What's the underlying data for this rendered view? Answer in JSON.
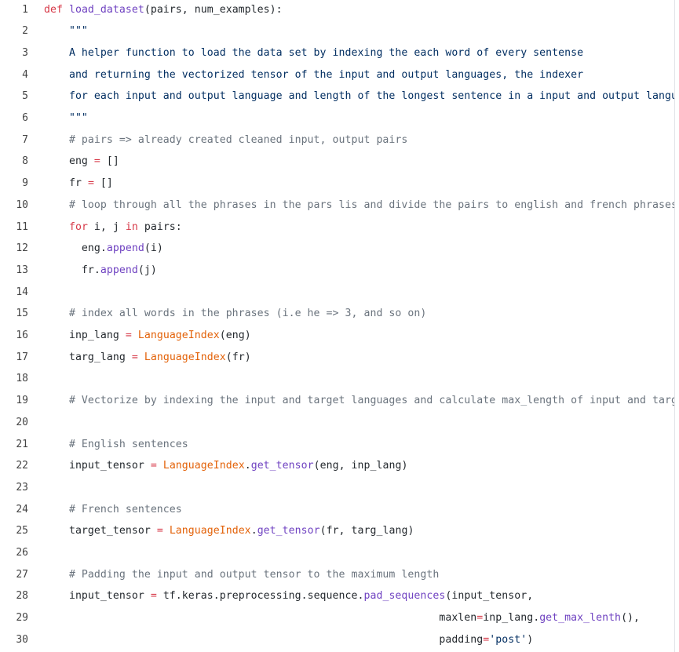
{
  "code_lines": [
    {
      "num": "1",
      "tokens": [
        {
          "t": "def ",
          "c": "k"
        },
        {
          "t": "load_dataset",
          "c": "f"
        },
        {
          "t": "(pairs, num_examples):",
          "c": ""
        }
      ]
    },
    {
      "num": "2",
      "tokens": [
        {
          "t": "    \"\"\"",
          "c": "s"
        }
      ]
    },
    {
      "num": "3",
      "tokens": [
        {
          "t": "    A helper function to load the data set by indexing the each word of every sentense",
          "c": "s"
        }
      ]
    },
    {
      "num": "4",
      "tokens": [
        {
          "t": "    and returning the vectorized tensor of the input and output languages, the indexer",
          "c": "s"
        }
      ]
    },
    {
      "num": "5",
      "tokens": [
        {
          "t": "    for each input and output language and length of the longest sentence in a input and output language",
          "c": "s"
        }
      ]
    },
    {
      "num": "6",
      "tokens": [
        {
          "t": "    \"\"\"",
          "c": "s"
        }
      ]
    },
    {
      "num": "7",
      "tokens": [
        {
          "t": "    # pairs => already created cleaned input, output pairs",
          "c": "c"
        }
      ]
    },
    {
      "num": "8",
      "tokens": [
        {
          "t": "    eng ",
          "c": ""
        },
        {
          "t": "=",
          "c": "o"
        },
        {
          "t": " []",
          "c": ""
        }
      ]
    },
    {
      "num": "9",
      "tokens": [
        {
          "t": "    fr ",
          "c": ""
        },
        {
          "t": "=",
          "c": "o"
        },
        {
          "t": " []",
          "c": ""
        }
      ]
    },
    {
      "num": "10",
      "tokens": [
        {
          "t": "    # loop through all the phrases in the pars lis and divide the pairs to english and french phrases",
          "c": "c"
        }
      ]
    },
    {
      "num": "11",
      "tokens": [
        {
          "t": "    ",
          "c": ""
        },
        {
          "t": "for",
          "c": "k"
        },
        {
          "t": " i, j ",
          "c": ""
        },
        {
          "t": "in",
          "c": "k"
        },
        {
          "t": " pairs:",
          "c": ""
        }
      ]
    },
    {
      "num": "12",
      "tokens": [
        {
          "t": "      eng.",
          "c": ""
        },
        {
          "t": "append",
          "c": "f"
        },
        {
          "t": "(i)",
          "c": ""
        }
      ]
    },
    {
      "num": "13",
      "tokens": [
        {
          "t": "      fr.",
          "c": ""
        },
        {
          "t": "append",
          "c": "f"
        },
        {
          "t": "(j)",
          "c": ""
        }
      ]
    },
    {
      "num": "14",
      "tokens": []
    },
    {
      "num": "15",
      "tokens": [
        {
          "t": "    # index all words in the phrases (i.e he => 3, and so on)",
          "c": "c"
        }
      ]
    },
    {
      "num": "16",
      "tokens": [
        {
          "t": "    inp_lang ",
          "c": ""
        },
        {
          "t": "=",
          "c": "o"
        },
        {
          "t": " ",
          "c": ""
        },
        {
          "t": "LanguageIndex",
          "c": "cl"
        },
        {
          "t": "(eng)",
          "c": ""
        }
      ]
    },
    {
      "num": "17",
      "tokens": [
        {
          "t": "    targ_lang ",
          "c": ""
        },
        {
          "t": "=",
          "c": "o"
        },
        {
          "t": " ",
          "c": ""
        },
        {
          "t": "LanguageIndex",
          "c": "cl"
        },
        {
          "t": "(fr)",
          "c": ""
        }
      ]
    },
    {
      "num": "18",
      "tokens": []
    },
    {
      "num": "19",
      "tokens": [
        {
          "t": "    # Vectorize by indexing the input and target languages and calculate max_length of input and target",
          "c": "c"
        }
      ]
    },
    {
      "num": "20",
      "tokens": []
    },
    {
      "num": "21",
      "tokens": [
        {
          "t": "    # English sentences",
          "c": "c"
        }
      ]
    },
    {
      "num": "22",
      "tokens": [
        {
          "t": "    input_tensor ",
          "c": ""
        },
        {
          "t": "=",
          "c": "o"
        },
        {
          "t": " ",
          "c": ""
        },
        {
          "t": "LanguageIndex",
          "c": "cl"
        },
        {
          "t": ".",
          "c": ""
        },
        {
          "t": "get_tensor",
          "c": "f"
        },
        {
          "t": "(eng, inp_lang)",
          "c": ""
        }
      ]
    },
    {
      "num": "23",
      "tokens": []
    },
    {
      "num": "24",
      "tokens": [
        {
          "t": "    # French sentences",
          "c": "c"
        }
      ]
    },
    {
      "num": "25",
      "tokens": [
        {
          "t": "    target_tensor ",
          "c": ""
        },
        {
          "t": "=",
          "c": "o"
        },
        {
          "t": " ",
          "c": ""
        },
        {
          "t": "LanguageIndex",
          "c": "cl"
        },
        {
          "t": ".",
          "c": ""
        },
        {
          "t": "get_tensor",
          "c": "f"
        },
        {
          "t": "(fr, targ_lang)",
          "c": ""
        }
      ]
    },
    {
      "num": "26",
      "tokens": []
    },
    {
      "num": "27",
      "tokens": [
        {
          "t": "    # Padding the input and output tensor to the maximum length",
          "c": "c"
        }
      ]
    },
    {
      "num": "28",
      "tokens": [
        {
          "t": "    input_tensor ",
          "c": ""
        },
        {
          "t": "=",
          "c": "o"
        },
        {
          "t": " tf.keras.preprocessing.sequence.",
          "c": ""
        },
        {
          "t": "pad_sequences",
          "c": "f"
        },
        {
          "t": "(input_tensor,",
          "c": ""
        }
      ]
    },
    {
      "num": "29",
      "tokens": [
        {
          "t": "                                                               maxlen",
          "c": ""
        },
        {
          "t": "=",
          "c": "o"
        },
        {
          "t": "inp_lang.",
          "c": ""
        },
        {
          "t": "get_max_lenth",
          "c": "f"
        },
        {
          "t": "(),",
          "c": ""
        }
      ]
    },
    {
      "num": "30",
      "tokens": [
        {
          "t": "                                                               padding",
          "c": ""
        },
        {
          "t": "=",
          "c": "o"
        },
        {
          "t": "'post'",
          "c": "s"
        },
        {
          "t": ")",
          "c": ""
        }
      ]
    }
  ]
}
